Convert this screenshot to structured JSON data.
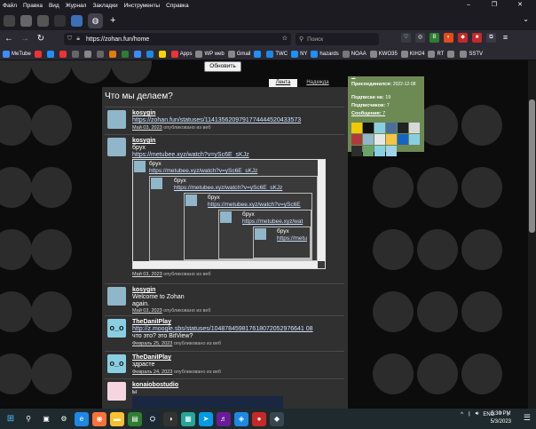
{
  "menubar": {
    "items": [
      "Файл",
      "Правка",
      "Вид",
      "Журнал",
      "Закладки",
      "Инструменты",
      "Справка"
    ]
  },
  "window": {
    "minimize": "–",
    "maximize": "❐",
    "close": "✕"
  },
  "tabs": {
    "new_tab": "+",
    "list": "⌄"
  },
  "navbar": {
    "back": "←",
    "forward": "→",
    "reload": "↻",
    "url": "https://zohan.fun/home",
    "search_placeholder": "Поиск",
    "menu": "≡"
  },
  "bookmarks": [
    {
      "label": "MeTube",
      "color": "#3d8bfd"
    },
    {
      "label": "",
      "color": "#e33"
    },
    {
      "label": "",
      "color": "#1e90ff"
    },
    {
      "label": "",
      "color": "#e33"
    },
    {
      "label": "",
      "color": "#666"
    },
    {
      "label": "",
      "color": "#888"
    },
    {
      "label": "",
      "color": "#666"
    },
    {
      "label": "",
      "color": "#e87b00"
    },
    {
      "label": "",
      "color": "#2e7d32"
    },
    {
      "label": "",
      "color": "#3d8bfd"
    },
    {
      "label": "",
      "color": "#1e88e5"
    },
    {
      "label": "",
      "color": "#ffd200"
    },
    {
      "label": "Apps",
      "color": "#e33"
    },
    {
      "label": "WP web",
      "color": "#888"
    },
    {
      "label": "Gmail",
      "color": "#888"
    },
    {
      "label": "",
      "color": "#1e90ff"
    },
    {
      "label": "TWC",
      "color": "#1e88e5"
    },
    {
      "label": "NY",
      "color": "#1e90ff"
    },
    {
      "label": "hazards",
      "color": "#1e90ff"
    },
    {
      "label": "NOAA",
      "color": "#777"
    },
    {
      "label": "KWO35",
      "color": "#888"
    },
    {
      "label": "KIH24",
      "color": "#888"
    },
    {
      "label": "RT",
      "color": "#888"
    },
    {
      "label": "",
      "color": "#888"
    },
    {
      "label": "SSTV",
      "color": "#888"
    }
  ],
  "page": {
    "refresh_label": "Обновить",
    "tab_active": "Лента",
    "tab_other": "Надежда",
    "heading": "Что мы делаем?"
  },
  "posts": [
    {
      "author": "kosygin",
      "link": "https://zohan.fun/statuses/1141356209791774444520433573",
      "date": "Май 03, 2023",
      "meta_suffix": " опубликовано из веб"
    },
    {
      "author": "kosygin",
      "text": "брух",
      "link": "https://metubee.xyz/watch?v=ySc6E_sKJz",
      "date": "Май 03, 2023",
      "meta_suffix": " опубликовано из веб",
      "embeds": [
        {
          "text": "брух",
          "link": "https://metubee.xyz/watch?v=ySc6E_sKJz"
        },
        {
          "text": "брух",
          "link": "https://metubee.xyz/watch?v=ySc6E_sKJz"
        },
        {
          "text": "брух",
          "link": "https://metubee.xyz/watch?v=ySc6E"
        },
        {
          "text": "брух",
          "link": "https://metubee.xyz/wat"
        },
        {
          "text": "брух",
          "link": "https://metu"
        }
      ]
    },
    {
      "author": "kosygin",
      "text": "Welcome to Zohan",
      "text2": "again.",
      "date": "Май 03, 2023",
      "meta_suffix": " опубликовано из веб"
    },
    {
      "author": "TheDaniIPlay",
      "link": "http://z.moogle.sbs/statuses/104878459817618072052976641 08",
      "text": "что это? это BitView?",
      "date": "Февраль 25, 2023",
      "meta_suffix": " опубликовано из веб",
      "avatar_text": "o_o"
    },
    {
      "author": "TheDaniIPlay",
      "text": "здрасте",
      "date": "Февраль 24, 2023",
      "meta_suffix": " опубликовано из веб",
      "avatar_text": "o_o"
    },
    {
      "author": "konaiobostudio",
      "text": "ы"
    }
  ],
  "profile": {
    "name_partial": "...",
    "joined_label": "Присоединился:",
    "joined_value": "2022-12-08",
    "following_label": "Подписан на:",
    "following_value": "19",
    "followers_label": "Подписчиков:",
    "followers_value": "7",
    "posts_label": "Сообщения:",
    "posts_value": "7"
  },
  "taskbar": {
    "tray_lang": "ENG",
    "time": "5:30 PM",
    "date": "5/3/2023",
    "up_arrow": "^"
  }
}
